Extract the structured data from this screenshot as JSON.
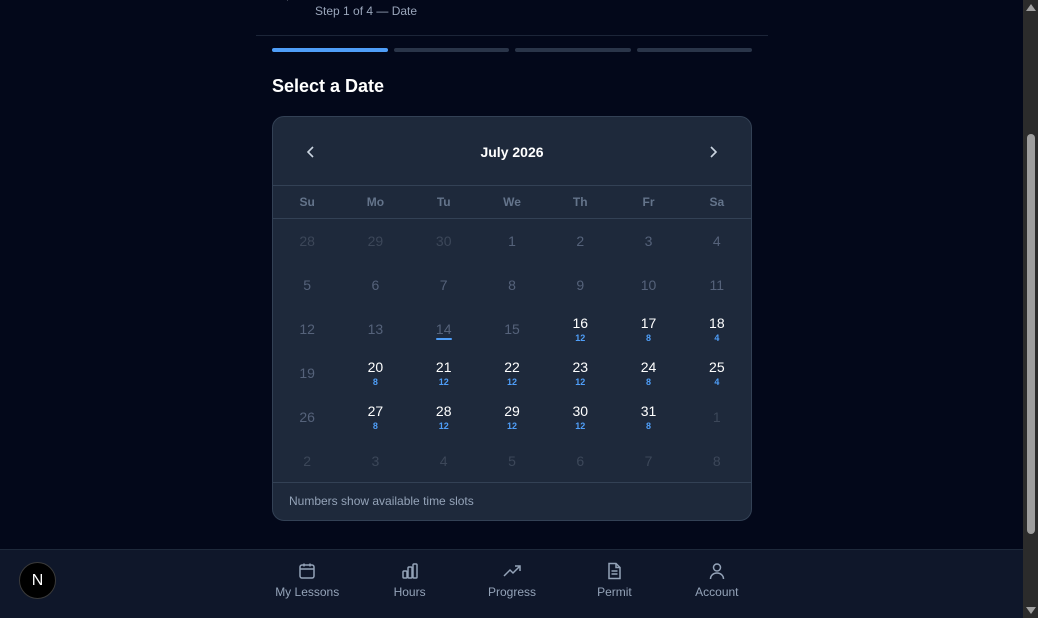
{
  "header": {
    "step_text": "Step 1 of 4 — Date"
  },
  "progress": {
    "total_steps": 4,
    "current_step": 1
  },
  "section_title": "Select a Date",
  "calendar": {
    "month_label": "July 2026",
    "weekdays": [
      "Su",
      "Mo",
      "Tu",
      "We",
      "Th",
      "Fr",
      "Sa"
    ],
    "weeks": [
      [
        {
          "d": "28",
          "s": "out"
        },
        {
          "d": "29",
          "s": "out"
        },
        {
          "d": "30",
          "s": "out"
        },
        {
          "d": "1",
          "s": "dis"
        },
        {
          "d": "2",
          "s": "dis"
        },
        {
          "d": "3",
          "s": "dis"
        },
        {
          "d": "4",
          "s": "dis"
        }
      ],
      [
        {
          "d": "5",
          "s": "dis"
        },
        {
          "d": "6",
          "s": "dis"
        },
        {
          "d": "7",
          "s": "dis"
        },
        {
          "d": "8",
          "s": "dis"
        },
        {
          "d": "9",
          "s": "dis"
        },
        {
          "d": "10",
          "s": "dis"
        },
        {
          "d": "11",
          "s": "dis"
        }
      ],
      [
        {
          "d": "12",
          "s": "dis"
        },
        {
          "d": "13",
          "s": "dis"
        },
        {
          "d": "14",
          "s": "dis",
          "today": true
        },
        {
          "d": "15",
          "s": "dis"
        },
        {
          "d": "16",
          "s": "avail",
          "slots": "12"
        },
        {
          "d": "17",
          "s": "avail",
          "slots": "8"
        },
        {
          "d": "18",
          "s": "avail",
          "slots": "4"
        }
      ],
      [
        {
          "d": "19",
          "s": "dis"
        },
        {
          "d": "20",
          "s": "avail",
          "slots": "8"
        },
        {
          "d": "21",
          "s": "avail",
          "slots": "12"
        },
        {
          "d": "22",
          "s": "avail",
          "slots": "12"
        },
        {
          "d": "23",
          "s": "avail",
          "slots": "12"
        },
        {
          "d": "24",
          "s": "avail",
          "slots": "8"
        },
        {
          "d": "25",
          "s": "avail",
          "slots": "4"
        }
      ],
      [
        {
          "d": "26",
          "s": "dis"
        },
        {
          "d": "27",
          "s": "avail",
          "slots": "8"
        },
        {
          "d": "28",
          "s": "avail",
          "slots": "12"
        },
        {
          "d": "29",
          "s": "avail",
          "slots": "12"
        },
        {
          "d": "30",
          "s": "avail",
          "slots": "12"
        },
        {
          "d": "31",
          "s": "avail",
          "slots": "8"
        },
        {
          "d": "1",
          "s": "out"
        }
      ],
      [
        {
          "d": "2",
          "s": "out"
        },
        {
          "d": "3",
          "s": "out"
        },
        {
          "d": "4",
          "s": "out"
        },
        {
          "d": "5",
          "s": "out"
        },
        {
          "d": "6",
          "s": "out"
        },
        {
          "d": "7",
          "s": "out"
        },
        {
          "d": "8",
          "s": "out"
        }
      ]
    ],
    "footer_note": "Numbers show available time slots"
  },
  "bottom_nav": {
    "items": [
      {
        "label": "My Lessons",
        "icon": "calendar-icon"
      },
      {
        "label": "Hours",
        "icon": "bar-chart-icon"
      },
      {
        "label": "Progress",
        "icon": "trending-up-icon"
      },
      {
        "label": "Permit",
        "icon": "document-icon"
      },
      {
        "label": "Account",
        "icon": "user-icon"
      }
    ]
  },
  "badge": {
    "letter": "N"
  },
  "colors": {
    "background": "#03081a",
    "card": "#1e293b",
    "accent": "#4f9ef8",
    "muted_text": "#94a3b8"
  }
}
